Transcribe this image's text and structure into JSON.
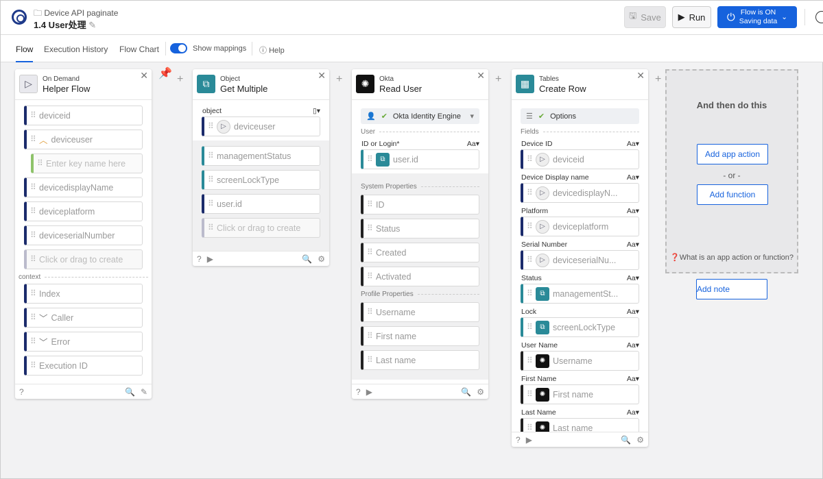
{
  "header": {
    "folder": "Device API paginate",
    "title": "1.4 User处理",
    "save": "Save",
    "run": "Run",
    "flow_status": "Flow is ON",
    "flow_sub": "Saving data"
  },
  "tabs": [
    {
      "label": "Flow",
      "active": true
    },
    {
      "label": "Execution History"
    },
    {
      "label": "Flow Chart"
    }
  ],
  "show_mappings": "Show mappings",
  "help": "Help",
  "cards": [
    {
      "app": "On Demand",
      "name": "Helper Flow",
      "icon": "play",
      "blocks": [
        {
          "f": "deviceid"
        },
        {
          "f": "deviceuser",
          "chev": "^"
        },
        {
          "f": "Enter key name here",
          "t": "key"
        },
        {
          "f": "devicedisplayName"
        },
        {
          "f": "deviceplatform"
        },
        {
          "f": "deviceserialNumber"
        },
        {
          "f": "Click or drag to create",
          "t": "ph"
        },
        {
          "s": "context",
          "nodash": true
        },
        {
          "f": "Index"
        },
        {
          "f": "Caller",
          "chev": "v"
        },
        {
          "f": "Error",
          "chev": "v"
        },
        {
          "f": "Execution ID"
        }
      ],
      "foot": [
        "?",
        "",
        "🔍",
        "✎"
      ]
    },
    {
      "app": "Object",
      "name": "Get Multiple",
      "icon": "obj",
      "blocks": [
        {
          "l": "object",
          "aa": "▯▾"
        },
        {
          "f": "deviceuser",
          "pill": "play"
        },
        {
          "grey": true
        },
        {
          "f": "managementStatus",
          "t": "teal"
        },
        {
          "f": "screenLockType",
          "t": "teal"
        },
        {
          "f": "user.id"
        },
        {
          "f": "Click or drag to create",
          "t": "ph"
        }
      ],
      "foot": [
        "?",
        "▶",
        "🔍",
        "⚙"
      ]
    },
    {
      "app": "Okta",
      "name": "Read User",
      "icon": "okta",
      "blocks": [
        {
          "sel": "Okta Identity Engine"
        },
        {
          "s": "User"
        },
        {
          "l": "ID or Login*",
          "aa": "Aa▾"
        },
        {
          "f": "user.id",
          "pill": "obj",
          "t": "teal"
        },
        {
          "grey": true
        },
        {
          "s": "System Properties"
        },
        {
          "f": "ID",
          "t": "plain"
        },
        {
          "f": "Status",
          "t": "plain"
        },
        {
          "f": "Created",
          "t": "plain"
        },
        {
          "f": "Activated",
          "t": "plain"
        },
        {
          "s": "Profile Properties"
        },
        {
          "f": "Username",
          "t": "plain"
        },
        {
          "f": "First name",
          "t": "plain"
        },
        {
          "f": "Last name",
          "t": "plain"
        }
      ],
      "foot": [
        "?",
        "▶",
        "🔍",
        "⚙"
      ]
    },
    {
      "app": "Tables",
      "name": "Create Row",
      "icon": "table",
      "blocks": [
        {
          "sel": "Options"
        },
        {
          "s": "Fields"
        },
        {
          "l": "Device ID",
          "aa": "Aa▾"
        },
        {
          "f": "deviceid",
          "pill": "play"
        },
        {
          "l": "Device Display name",
          "aa": "Aa▾"
        },
        {
          "f": "devicedisplayN...",
          "pill": "play"
        },
        {
          "l": "Platform",
          "aa": "Aa▾"
        },
        {
          "f": "deviceplatform",
          "pill": "play"
        },
        {
          "l": "Serial Number",
          "aa": "Aa▾"
        },
        {
          "f": "deviceserialNu...",
          "pill": "play"
        },
        {
          "l": "Status",
          "aa": "Aa▾"
        },
        {
          "f": "managementSt...",
          "pill": "obj",
          "t": "teal"
        },
        {
          "l": "Lock",
          "aa": "Aa▾"
        },
        {
          "f": "screenLockType",
          "pill": "obj",
          "t": "teal"
        },
        {
          "l": "User Name",
          "aa": "Aa▾"
        },
        {
          "f": "Username",
          "pill": "okta",
          "t": "plain"
        },
        {
          "l": "First Name",
          "aa": "Aa▾"
        },
        {
          "f": "First name",
          "pill": "okta",
          "t": "plain"
        },
        {
          "l": "Last Name",
          "aa": "Aa▾"
        },
        {
          "f": "Last name",
          "pill": "okta",
          "t": "plain"
        }
      ],
      "foot": [
        "?",
        "▶",
        "🔍",
        "⚙"
      ]
    }
  ],
  "next": {
    "title": "And then do this",
    "add_app_action": "Add app action",
    "or": "- or -",
    "add_function": "Add function",
    "what": "What is an app action or function?",
    "add_note": "Add note"
  }
}
